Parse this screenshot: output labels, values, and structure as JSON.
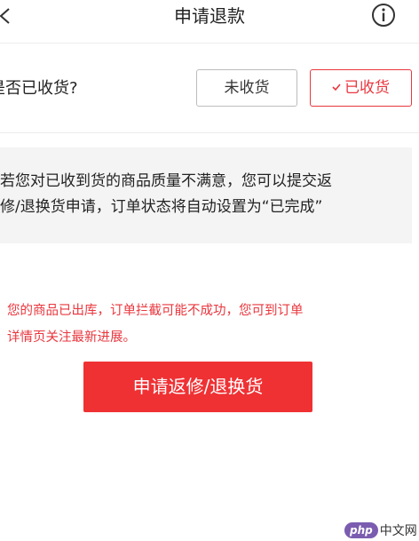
{
  "header": {
    "title": "申请退款",
    "back_icon": "chevron-left-icon",
    "info_icon": "info-circle-icon"
  },
  "received": {
    "question": "是否已收货?",
    "options": [
      {
        "label": "未收货",
        "selected": false
      },
      {
        "label": "已收货",
        "selected": true
      }
    ]
  },
  "note": {
    "lines": [
      "若您对已收到货的商品质量不满意，您可以提交返",
      "修/退换货申请，订单状态将自动设置为“已完成”"
    ]
  },
  "warning": {
    "lines": [
      "您的商品已出库，订单拦截可能不成功，您可到订单",
      "详情页关注最新进展。"
    ]
  },
  "primary_button": {
    "label": "申请返修/退换货"
  },
  "watermark": {
    "logo": "php",
    "text": "中文网"
  },
  "colors": {
    "accent": "#e8373e",
    "primary_button": "#ef3134",
    "note_background": "#f4f4f4",
    "divider": "#ececec"
  }
}
